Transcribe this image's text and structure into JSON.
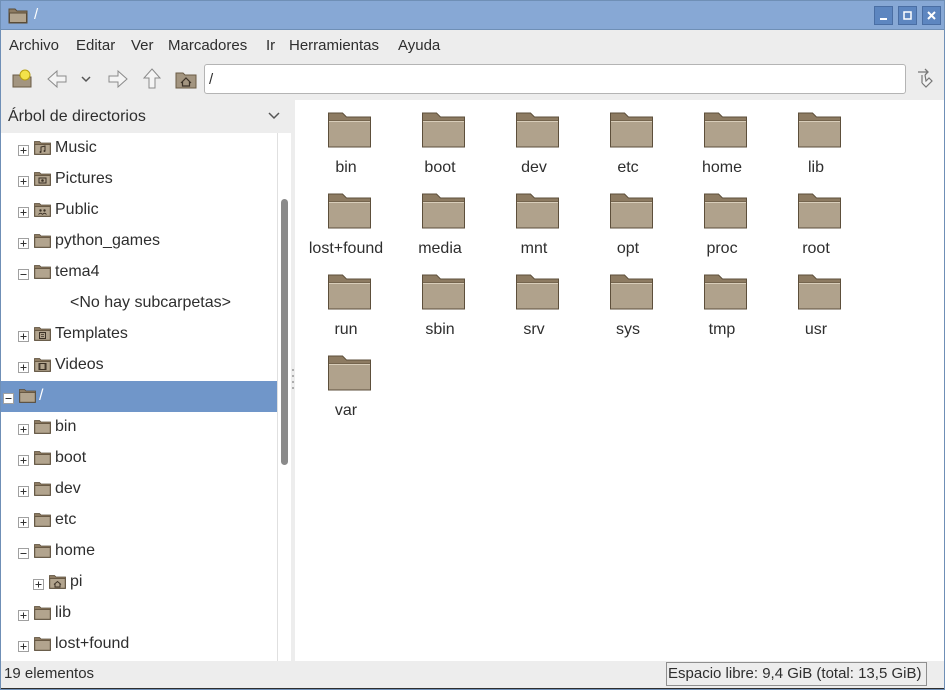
{
  "window": {
    "title": "/",
    "minimize_icon": "minimize-icon",
    "maximize_icon": "maximize-icon",
    "close_icon": "close-icon"
  },
  "menubar": {
    "items": [
      "Archivo",
      "Editar",
      "Ver",
      "Marcadores",
      "Ir",
      "Herramientas",
      "Ayuda"
    ]
  },
  "toolbar": {
    "buttons": [
      "new-tab-icon",
      "back-icon",
      "history-dropdown-icon",
      "forward-icon",
      "up-icon",
      "home-icon"
    ],
    "path_value": "/",
    "go_icon": "go-icon"
  },
  "sidebar": {
    "header": "Árbol de directorios",
    "header_icon": "chevron-down-icon",
    "tree": [
      {
        "label": "Music",
        "icon": "music-folder-icon",
        "expander": "plus",
        "depth": 1
      },
      {
        "label": "Pictures",
        "icon": "pictures-folder-icon",
        "expander": "plus",
        "depth": 1
      },
      {
        "label": "Public",
        "icon": "public-folder-icon",
        "expander": "plus",
        "depth": 1
      },
      {
        "label": "python_games",
        "icon": "folder-icon",
        "expander": "plus",
        "depth": 1
      },
      {
        "label": "tema4",
        "icon": "folder-icon",
        "expander": "minus",
        "depth": 1
      },
      {
        "label": "<No hay subcarpetas>",
        "icon": "",
        "expander": "",
        "depth": 2
      },
      {
        "label": "Templates",
        "icon": "templates-folder-icon",
        "expander": "plus",
        "depth": 1
      },
      {
        "label": "Videos",
        "icon": "videos-folder-icon",
        "expander": "plus",
        "depth": 1
      },
      {
        "label": "/",
        "icon": "folder-icon",
        "expander": "minus",
        "depth": 0,
        "selected": true
      },
      {
        "label": "bin",
        "icon": "folder-icon",
        "expander": "plus",
        "depth": 1
      },
      {
        "label": "boot",
        "icon": "folder-icon",
        "expander": "plus",
        "depth": 1
      },
      {
        "label": "dev",
        "icon": "folder-icon",
        "expander": "plus",
        "depth": 1
      },
      {
        "label": "etc",
        "icon": "folder-icon",
        "expander": "plus",
        "depth": 1
      },
      {
        "label": "home",
        "icon": "folder-icon",
        "expander": "minus",
        "depth": 1
      },
      {
        "label": "pi",
        "icon": "home-folder-icon",
        "expander": "plus",
        "depth": 2
      },
      {
        "label": "lib",
        "icon": "folder-icon",
        "expander": "plus",
        "depth": 1
      },
      {
        "label": "lost+found",
        "icon": "folder-icon",
        "expander": "plus",
        "depth": 1
      }
    ]
  },
  "files": [
    "bin",
    "boot",
    "dev",
    "etc",
    "home",
    "lib",
    "lost+found",
    "media",
    "mnt",
    "opt",
    "proc",
    "root",
    "run",
    "sbin",
    "srv",
    "sys",
    "tmp",
    "usr",
    "var"
  ],
  "statusbar": {
    "count": "19 elementos",
    "free_space": "Espacio libre: 9,4 GiB (total: 13,5 GiB)"
  },
  "colors": {
    "titlebar": "#87a8d5",
    "selection": "#7096c9",
    "folder": "#a39580"
  }
}
